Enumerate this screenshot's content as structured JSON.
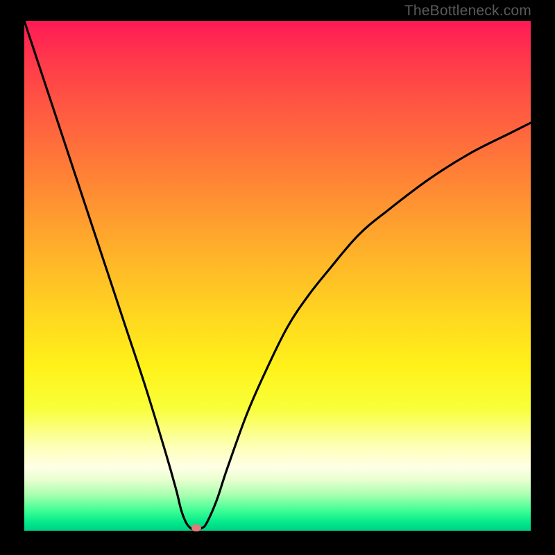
{
  "watermark": "TheBottleneck.com",
  "colors": {
    "page_bg": "#000000",
    "gradient_top": "#ff1a55",
    "gradient_bottom": "#00d085",
    "curve": "#000000",
    "marker": "#e27a78"
  },
  "chart_data": {
    "type": "line",
    "title": "",
    "xlabel": "",
    "ylabel": "",
    "xlim": [
      0,
      100
    ],
    "ylim": [
      0,
      100
    ],
    "series": [
      {
        "name": "bottleneck-curve",
        "x": [
          0,
          4,
          8,
          12,
          16,
          20,
          24,
          28,
          30,
          31,
          32,
          33,
          34,
          35,
          36,
          38,
          40,
          44,
          48,
          52,
          56,
          60,
          66,
          72,
          80,
          88,
          96,
          100
        ],
        "y": [
          100,
          88,
          76,
          64,
          52,
          40,
          28,
          15,
          8,
          4,
          1.5,
          0.4,
          0.2,
          0.5,
          1.5,
          6,
          12,
          23,
          32,
          40,
          46,
          51,
          58,
          63,
          69,
          74,
          78,
          80
        ]
      }
    ],
    "annotations": [
      {
        "name": "min-marker",
        "x": 34,
        "y": 0.6
      }
    ]
  }
}
